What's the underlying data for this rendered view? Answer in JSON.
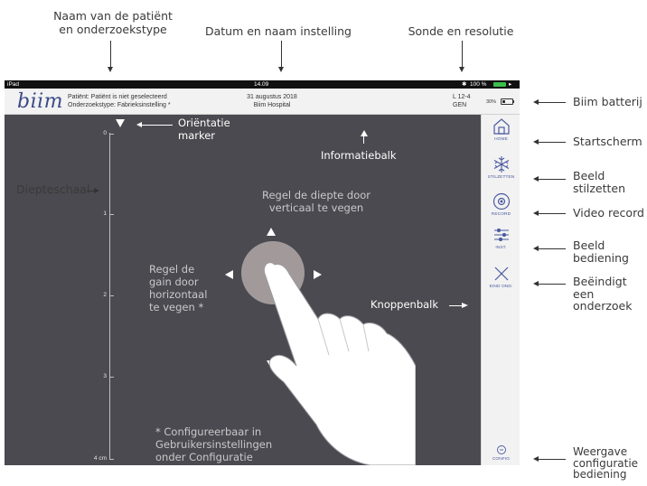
{
  "callouts_top": {
    "patient": "Naam van de patiënt\nen onderzoekstype",
    "date_hospital": "Datum en naam instelling",
    "probe": "Sonde en resolutie"
  },
  "statusbar": {
    "device": "iPad",
    "time": "14.09",
    "battery": "100 %"
  },
  "infobar": {
    "logo": "biim",
    "patient_line": "Patiënt: Patiënt is niet geselecteerd",
    "exam_line": "Onderzoekstype: Fabrieksinstelling *",
    "date": "31 augustus 2018",
    "hospital": "Biim Hospital",
    "probe": "L 12-4",
    "preset": "GEN",
    "probe_battery": "30%",
    "probe_battery_level": 0.3
  },
  "main": {
    "orientation_label": "Oriëntatie\nmarker",
    "infobar_label": "Informatiebalk",
    "depth_instruction": "Regel de diepte door\nverticaal te vegen",
    "gain_instruction": "Regel de\ngain door\nhorizontaal\nte vegen *",
    "buttonbar_label": "Knoppenbalk",
    "config_note": "* Configureerbaar in\nGebruikersinstellingen\nonder Configuratie",
    "depth_labels": [
      "0",
      "1",
      "2",
      "3",
      "4 cm"
    ]
  },
  "left_callout": "Diepteschaal",
  "sidebar": {
    "home": "HOME",
    "freeze": "STILZETTEN",
    "record": "RECORD",
    "settings": "INST.",
    "end": "EIND OND.",
    "config": "CONFIG"
  },
  "callouts_right": {
    "battery": "Biim batterij",
    "home": "Startscherm",
    "freeze": "Beeld\nstilzetten",
    "record": "Video record",
    "image_controls": "Beeld\nbediening",
    "end": "Beëindigt een\nonderzoek",
    "config": "Weergave\nconfiguratie\nbediening"
  },
  "colors": {
    "main_bg": "#4a4a50",
    "accent": "#4b5aa0",
    "logo": "#3c4a88",
    "probe_battery_green": "#3bbf4a"
  }
}
